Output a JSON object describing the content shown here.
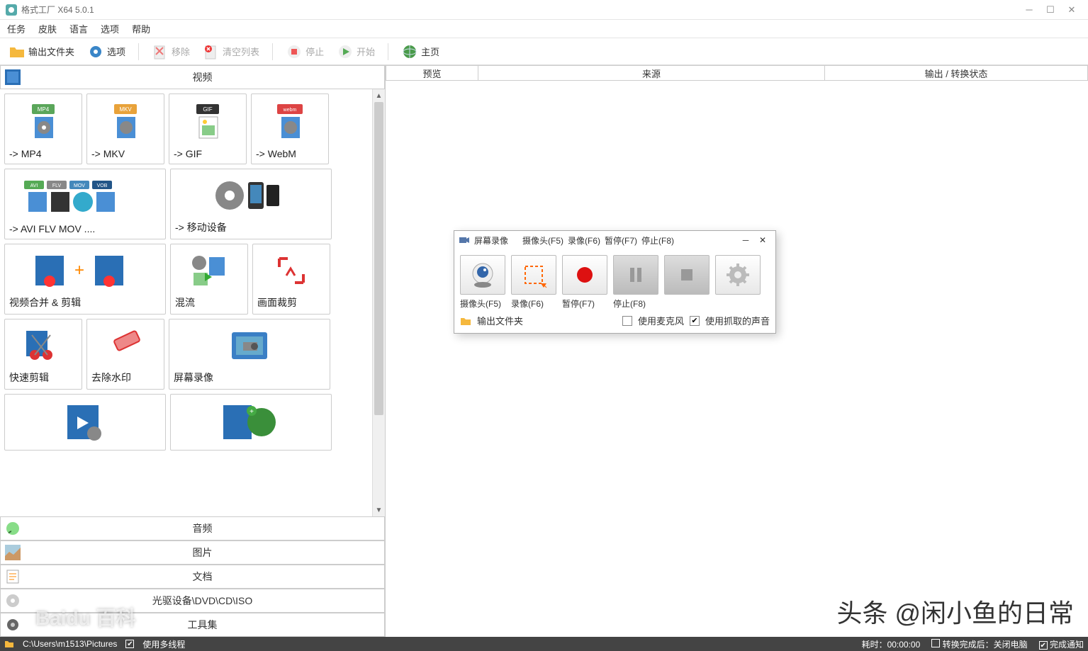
{
  "window": {
    "title": "格式工厂 X64 5.0.1"
  },
  "menubar": [
    "任务",
    "皮肤",
    "语言",
    "选项",
    "帮助"
  ],
  "toolbar": {
    "output_folder": "输出文件夹",
    "options": "选项",
    "remove": "移除",
    "clear_list": "清空列表",
    "stop": "停止",
    "start": "开始",
    "home": "主页"
  },
  "categories": {
    "video": "视频",
    "audio": "音频",
    "image": "图片",
    "document": "文档",
    "optical": "光驱设备\\DVD\\CD\\ISO",
    "tools": "工具集"
  },
  "cells": {
    "mp4": "-> MP4",
    "mkv": "-> MKV",
    "gif": "-> GIF",
    "webm": "-> WebM",
    "avi_etc": "-> AVI FLV MOV ....",
    "mobile": "-> 移动设备",
    "merge": "视频合并 & 剪辑",
    "mux": "混流",
    "crop": "画面裁剪",
    "quickcut": "快速剪辑",
    "dewm": "去除水印",
    "screenrec": "屏幕录像"
  },
  "right_header": {
    "preview": "预览",
    "source": "来源",
    "output": "输出 / 转换状态"
  },
  "dialog": {
    "title": "屏幕录像",
    "hints": [
      "摄像头(F5)",
      "录像(F6)",
      "暂停(F7)",
      "停止(F8)"
    ],
    "btn_labels": [
      "摄像头(F5)",
      "录像(F6)",
      "暂停(F7)",
      "停止(F8)"
    ],
    "output_folder": "输出文件夹",
    "use_mic": "使用麦克风",
    "use_capture_audio": "使用抓取的声音"
  },
  "statusbar": {
    "path": "C:\\Users\\m1513\\Pictures",
    "multithread": "使用多线程",
    "elapsed": "耗时：00:00:00",
    "after_done": "转换完成后：关闭电脑",
    "notify": "完成通知"
  },
  "watermark": "头条 @闲小鱼的日常",
  "baidu": "Baidu 百科"
}
